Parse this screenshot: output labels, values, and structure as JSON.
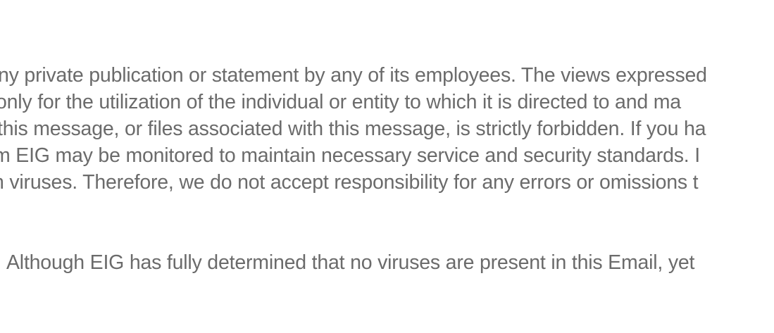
{
  "disclaimer": {
    "lines": [
      "ny private publication or statement by any of its employees. The views expressed",
      "only for the utilization of the individual or entity to which it is directed to and ma",
      "this message, or files associated with this message, is strictly forbidden. If you ha",
      "m EIG may be monitored to maintain necessary service and security standards. I",
      "n viruses. Therefore, we do not accept responsibility for any errors or omissions t"
    ]
  },
  "footer_note": "Although EIG has fully determined that no viruses are present in this Email, yet"
}
